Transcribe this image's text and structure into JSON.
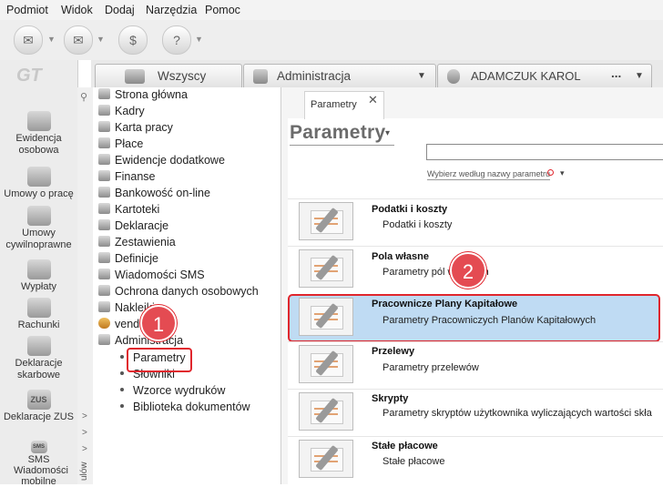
{
  "menu": [
    "Podmiot",
    "Widok",
    "Dodaj",
    "Narzędzia",
    "Pomoc"
  ],
  "app_logo": "GT",
  "window_tabs": [
    {
      "label": "Wszyscy"
    },
    {
      "label": "Administracja",
      "caret": "▼"
    },
    {
      "label": "ADAMCZUK KAROL",
      "caret": "..."
    }
  ],
  "sidebar": [
    {
      "label": "Ewidencja osobowa"
    },
    {
      "label": "Umowy o pracę"
    },
    {
      "label": "Umowy cywilnoprawne"
    },
    {
      "label": "Wypłaty"
    },
    {
      "label": "Rachunki"
    },
    {
      "label": "Deklaracje skarbowe"
    },
    {
      "label": "Deklaracje ZUS",
      "icon_text": "ZUS"
    },
    {
      "label": "SMS Wiadomości mobilne",
      "icon_text": "SMS"
    }
  ],
  "pin_panel_label": "ulów",
  "tree": {
    "nodes": [
      "Strona główna",
      "Kadry",
      "Karta pracy",
      "Płace",
      "Ewidencje dodatkowe",
      "Finanse",
      "Bankowość on-line",
      "Kartoteki",
      "Deklaracje",
      "Zestawienia",
      "Definicje",
      "Wiadomości SMS",
      "Ochrona danych osobowych",
      "Naklejki",
      "vendero",
      "Administracja"
    ],
    "children": [
      "Parametry",
      "Słowniki",
      "Wzorce wydruków",
      "Biblioteka dokumentów"
    ]
  },
  "doc_tab": {
    "label": "Parametry",
    "close": "✕"
  },
  "page": {
    "title": "Parametry",
    "caret": "▾",
    "search_hint": "Wybierz według nazwy parametru",
    "search_hint_caret": "▾",
    "search_value": ""
  },
  "params": [
    {
      "title": "Podatki i koszty",
      "desc": "Podatki i koszty"
    },
    {
      "title": "Pola własne",
      "desc": "Parametry pól własnych"
    },
    {
      "title": "Pracownicze Plany Kapitałowe",
      "desc": "Parametry Pracowniczych Planów Kapitałowych"
    },
    {
      "title": "Przelewy",
      "desc": "Parametry przelewów"
    },
    {
      "title": "Skrypty",
      "desc": "Parametry skryptów użytkownika wyliczających wartości skła"
    },
    {
      "title": "Stałe płacowe",
      "desc": "Stałe płacowe"
    }
  ],
  "badges": [
    "1",
    "2"
  ],
  "colors": {
    "highlight": "#bfdbf3",
    "annotation_red": "#e0262d",
    "badge_fill": "#e44b52"
  }
}
